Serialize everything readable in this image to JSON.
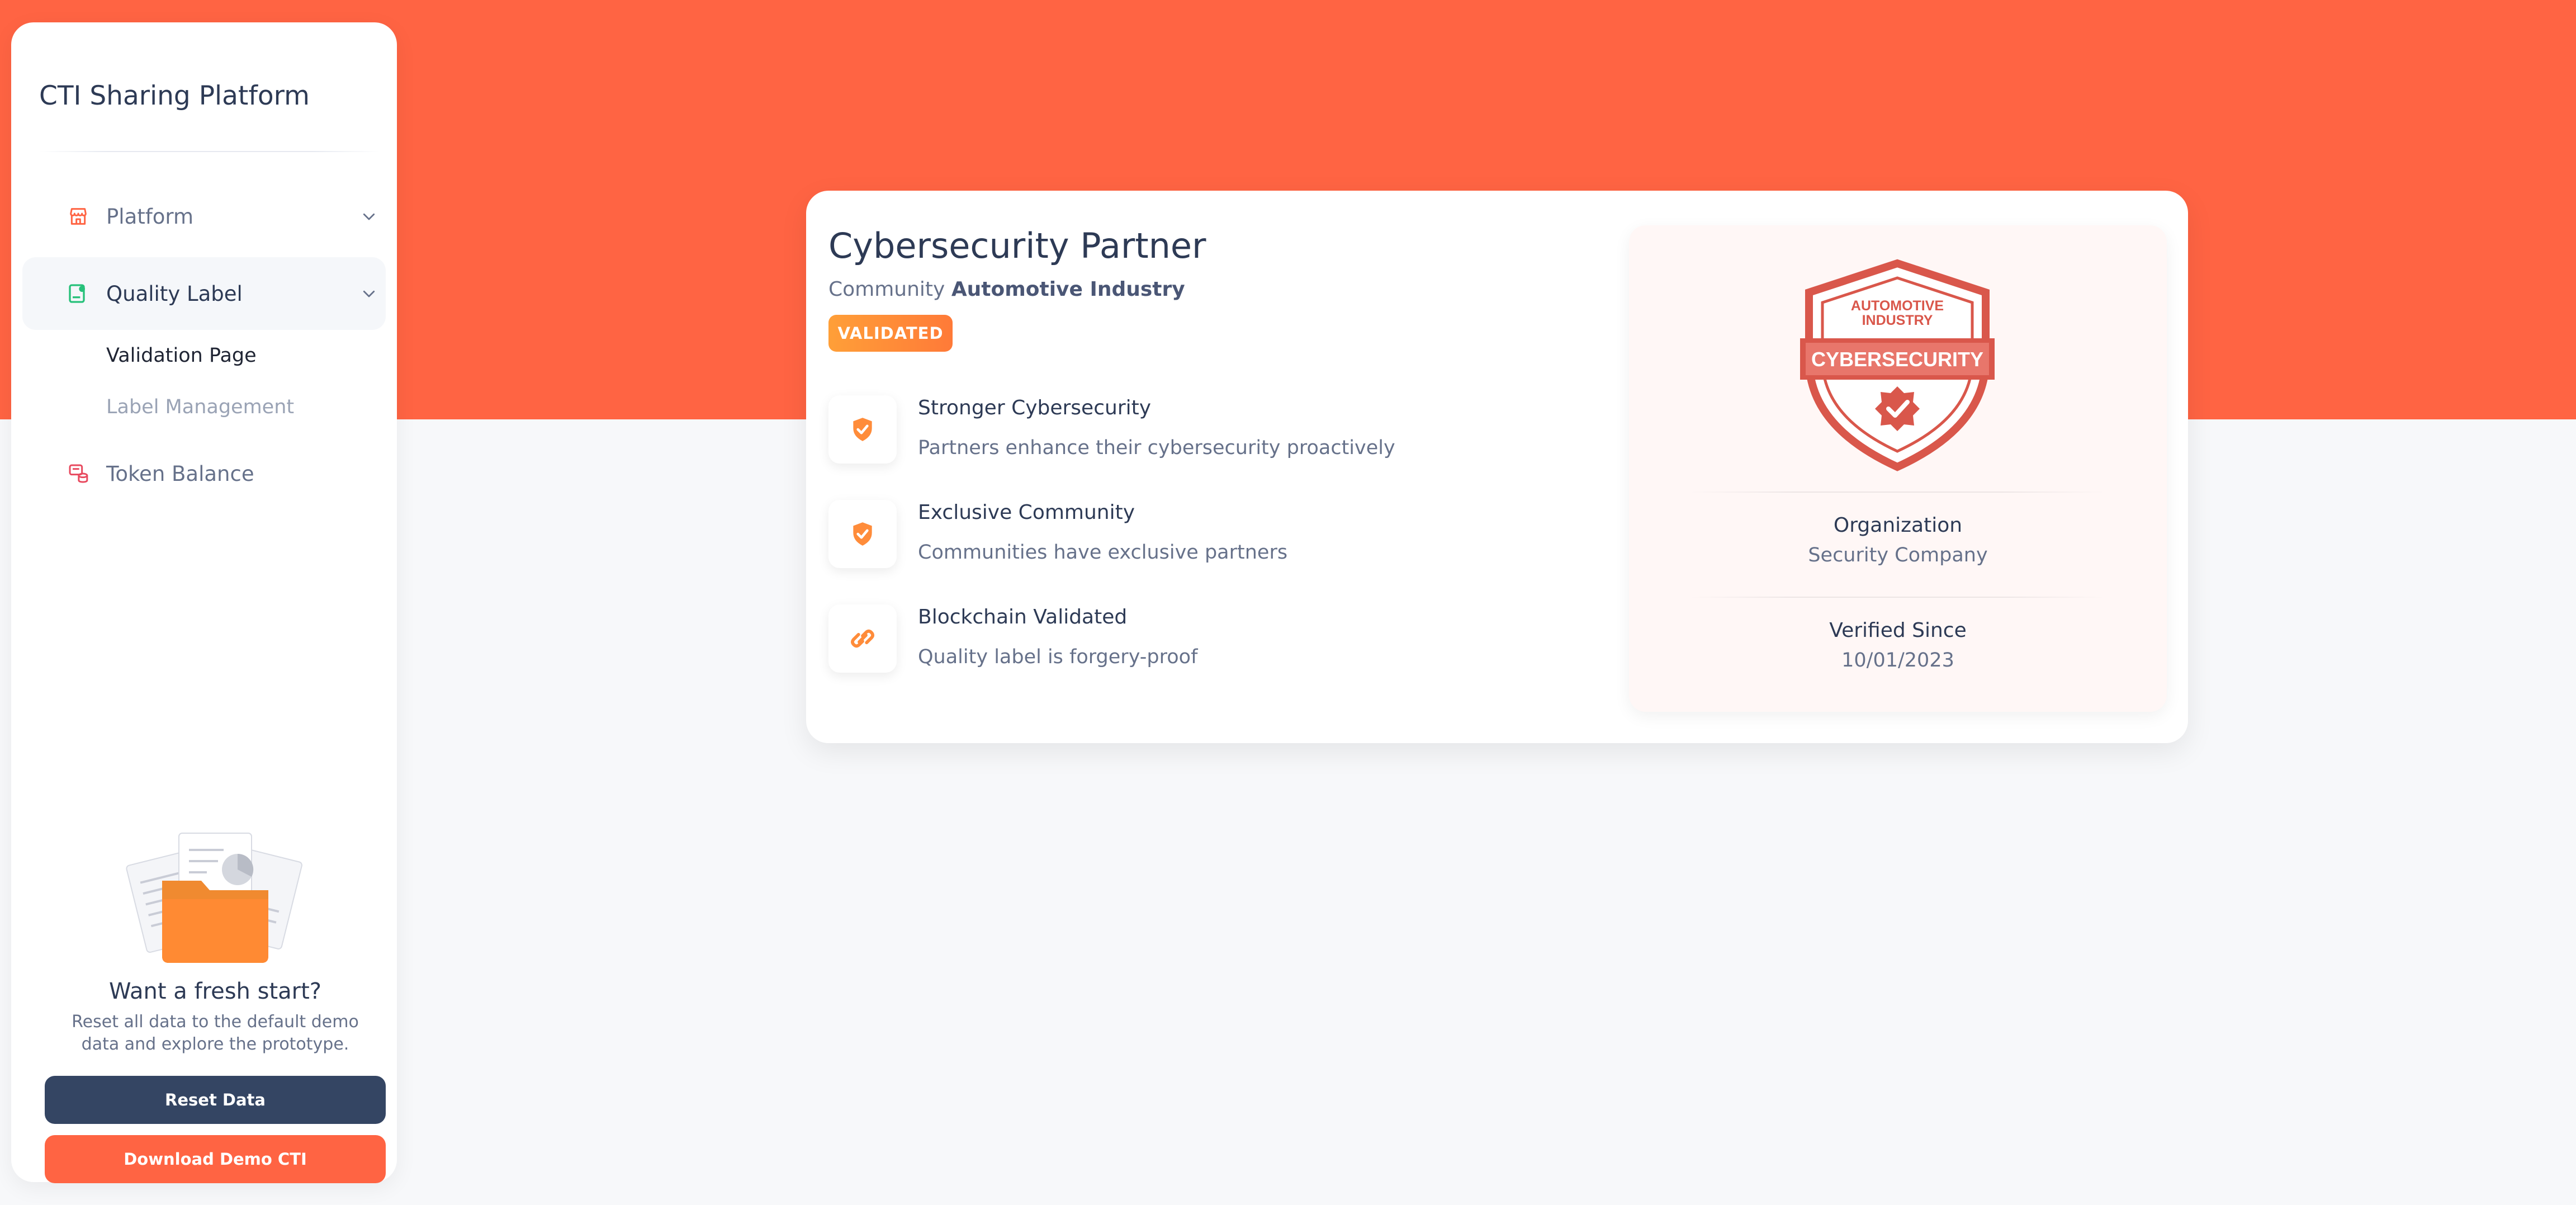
{
  "sidebar": {
    "brand": "CTI Sharing Platform",
    "items": [
      {
        "label": "Platform",
        "icon": "store-icon"
      },
      {
        "label": "Quality Label",
        "icon": "id-card-icon"
      },
      {
        "label": "Token Balance",
        "icon": "coins-icon"
      }
    ],
    "sub_items": [
      {
        "label": "Validation Page"
      },
      {
        "label": "Label Management"
      }
    ],
    "fresh": {
      "title": "Want a fresh start?",
      "description": "Reset all data to the default demo data and explore the prototype.",
      "reset_label": "Reset Data",
      "download_label": "Download Demo CTI"
    }
  },
  "card": {
    "title": "Cybersecurity Partner",
    "community_prefix": "Community",
    "community_name": "Automotive Industry",
    "status": "VALIDATED",
    "features": [
      {
        "title": "Stronger Cybersecurity",
        "description": "Partners enhance their cybersecurity proactively",
        "icon": "shield-check-icon"
      },
      {
        "title": "Exclusive Community",
        "description": "Communities have exclusive partners",
        "icon": "shield-check-icon"
      },
      {
        "title": "Blockchain Validated",
        "description": "Quality label is forgery-proof",
        "icon": "link-icon"
      }
    ],
    "seal": {
      "top_line1": "AUTOMOTIVE",
      "top_line2": "INDUSTRY",
      "banner": "CYBERSECURITY"
    },
    "organization_label": "Organization",
    "organization_value": "Security Company",
    "verified_label": "Verified Since",
    "verified_value": "10/01/2023"
  },
  "colors": {
    "accent": "#ff6443",
    "dark_button": "#344563",
    "seal_red": "#d9574b",
    "feature_orange": "#ff8c3a"
  }
}
